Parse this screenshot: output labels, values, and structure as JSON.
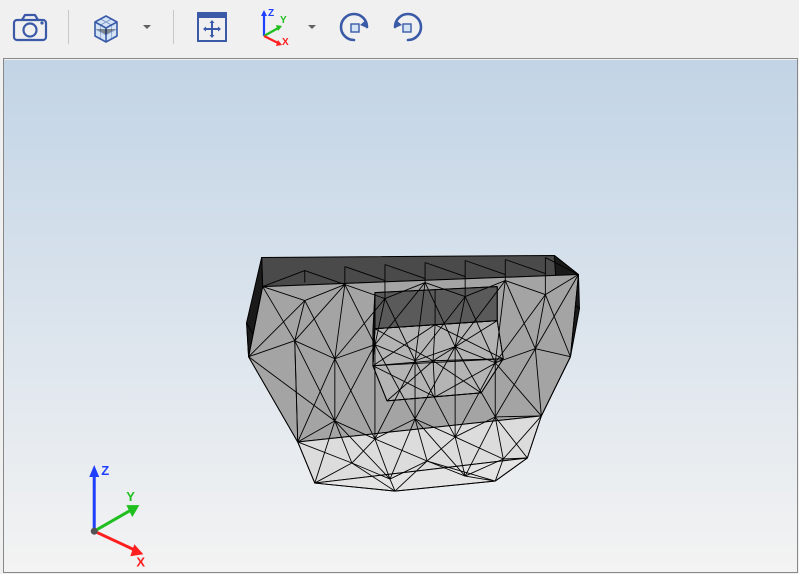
{
  "toolbar": {
    "items": [
      {
        "name": "camera-icon",
        "type": "camera"
      },
      {
        "name": "view-cube-icon",
        "type": "cube"
      },
      {
        "name": "dropdown-caret-icon",
        "type": "caret"
      },
      {
        "name": "pan-icon",
        "type": "pan"
      },
      {
        "name": "axes-triad-icon",
        "type": "triad",
        "labels": {
          "x": "X",
          "y": "Y",
          "z": "Z"
        }
      },
      {
        "name": "dropdown-caret-icon",
        "type": "caret"
      },
      {
        "name": "rotate-ccw-icon",
        "type": "rotccw"
      },
      {
        "name": "rotate-cw-icon",
        "type": "rotcw"
      }
    ]
  },
  "viewport": {
    "triad_labels": {
      "x": "X",
      "y": "Y",
      "z": "Z"
    },
    "colors": {
      "x_axis": "#ff1f1f",
      "y_axis": "#1fbf1f",
      "z_axis": "#1f3fff",
      "mesh_edge": "#000000",
      "mesh_fill_light": "#d8d8d8",
      "mesh_fill_mid": "#b8b8b8",
      "mesh_fill_dark": "#7a7a7a",
      "bg_top": "#c2d4e6",
      "bg_bottom": "#f3f3f3"
    }
  }
}
